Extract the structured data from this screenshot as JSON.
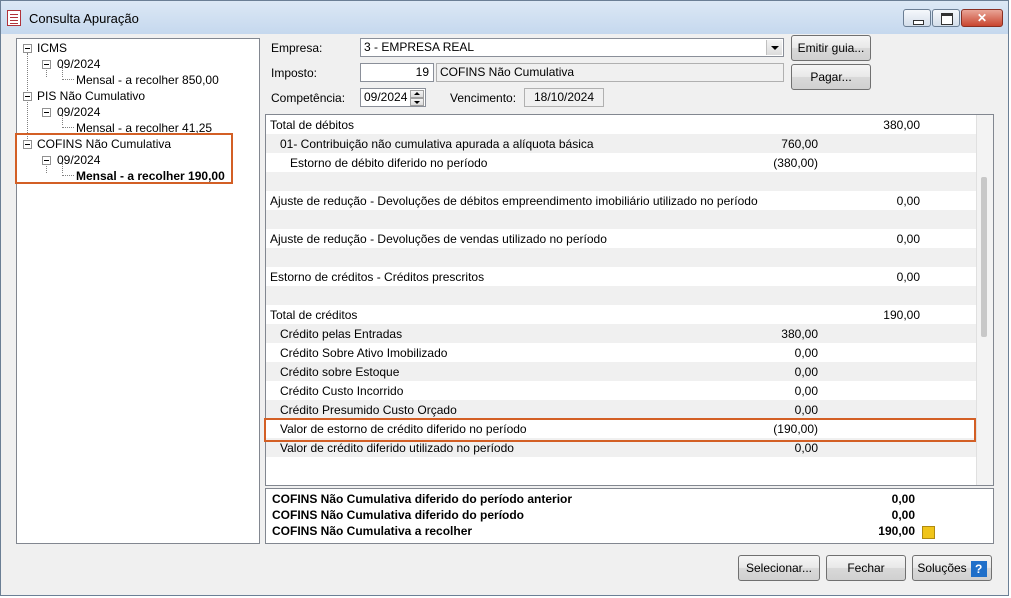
{
  "window": {
    "title": "Consulta Apuração"
  },
  "tree": {
    "nodes": [
      {
        "label": "ICMS",
        "level": 0
      },
      {
        "label": "09/2024",
        "level": 1
      },
      {
        "label": "Mensal - a recolher 850,00",
        "level": 2
      },
      {
        "label": "PIS Não Cumulativo",
        "level": 0
      },
      {
        "label": "09/2024",
        "level": 1
      },
      {
        "label": "Mensal - a recolher 41,25",
        "level": 2
      },
      {
        "label": "COFINS Não Cumulativa",
        "level": 0
      },
      {
        "label": "09/2024",
        "level": 1
      },
      {
        "label": "Mensal - a recolher 190,00",
        "level": 2,
        "selected": true
      }
    ]
  },
  "form": {
    "empresa_label": "Empresa:",
    "empresa_value": "3 - EMPRESA REAL",
    "imposto_label": "Imposto:",
    "imposto_code": "19",
    "imposto_name": "COFINS Não Cumulativa",
    "competencia_label": "Competência:",
    "competencia_value": "09/2024",
    "vencimento_label": "Vencimento:",
    "vencimento_value": "18/10/2024"
  },
  "buttons": {
    "emitir_guia": "Emitir guia...",
    "pagar": "Pagar...",
    "selecionar": "Selecionar...",
    "fechar": "Fechar",
    "solucoes": "Soluções",
    "help_glyph": "?"
  },
  "grid": {
    "rows": [
      {
        "desc": "Total de débitos",
        "value": "",
        "total": "380,00",
        "indent": 0
      },
      {
        "desc": "01- Contribuição não cumulativa apurada a alíquota básica",
        "value": "760,00",
        "total": "",
        "indent": 1
      },
      {
        "desc": "Estorno de débito diferido no período",
        "value": "(380,00)",
        "total": "",
        "indent": 2
      },
      {
        "desc": "",
        "value": "",
        "total": "",
        "indent": 0
      },
      {
        "desc": "Ajuste de redução - Devoluções de débitos empreendimento imobiliário utilizado no período",
        "value": "",
        "total": "0,00",
        "indent": 0
      },
      {
        "desc": "",
        "value": "",
        "total": "",
        "indent": 0
      },
      {
        "desc": "Ajuste de redução - Devoluções de vendas utilizado no período",
        "value": "",
        "total": "0,00",
        "indent": 0
      },
      {
        "desc": "",
        "value": "",
        "total": "",
        "indent": 0
      },
      {
        "desc": "Estorno de créditos - Créditos prescritos",
        "value": "",
        "total": "0,00",
        "indent": 0
      },
      {
        "desc": "",
        "value": "",
        "total": "",
        "indent": 0
      },
      {
        "desc": "Total de créditos",
        "value": "",
        "total": "190,00",
        "indent": 0
      },
      {
        "desc": "Crédito pelas Entradas",
        "value": "380,00",
        "total": "",
        "indent": 1
      },
      {
        "desc": "Crédito Sobre Ativo Imobilizado",
        "value": "0,00",
        "total": "",
        "indent": 1
      },
      {
        "desc": "Crédito sobre Estoque",
        "value": "0,00",
        "total": "",
        "indent": 1
      },
      {
        "desc": "Crédito Custo Incorrido",
        "value": "0,00",
        "total": "",
        "indent": 1
      },
      {
        "desc": "Crédito Presumido Custo Orçado",
        "value": "0,00",
        "total": "",
        "indent": 1
      },
      {
        "desc": "Valor de estorno de crédito diferido no período",
        "value": "(190,00)",
        "total": "",
        "indent": 1
      },
      {
        "desc": "Valor de crédito diferido utilizado no período",
        "value": "0,00",
        "total": "",
        "indent": 1
      }
    ]
  },
  "summary": {
    "rows": [
      {
        "label": "COFINS Não Cumulativa diferido do período anterior",
        "value": "0,00"
      },
      {
        "label": "COFINS Não Cumulativa diferido do período",
        "value": "0,00"
      },
      {
        "label": "COFINS Não Cumulativa a recolher",
        "value": "190,00"
      }
    ]
  },
  "colors": {
    "highlight": "#d35f25",
    "alt_row": "#f0f0f0",
    "help_icon": "#1f6fc9"
  }
}
